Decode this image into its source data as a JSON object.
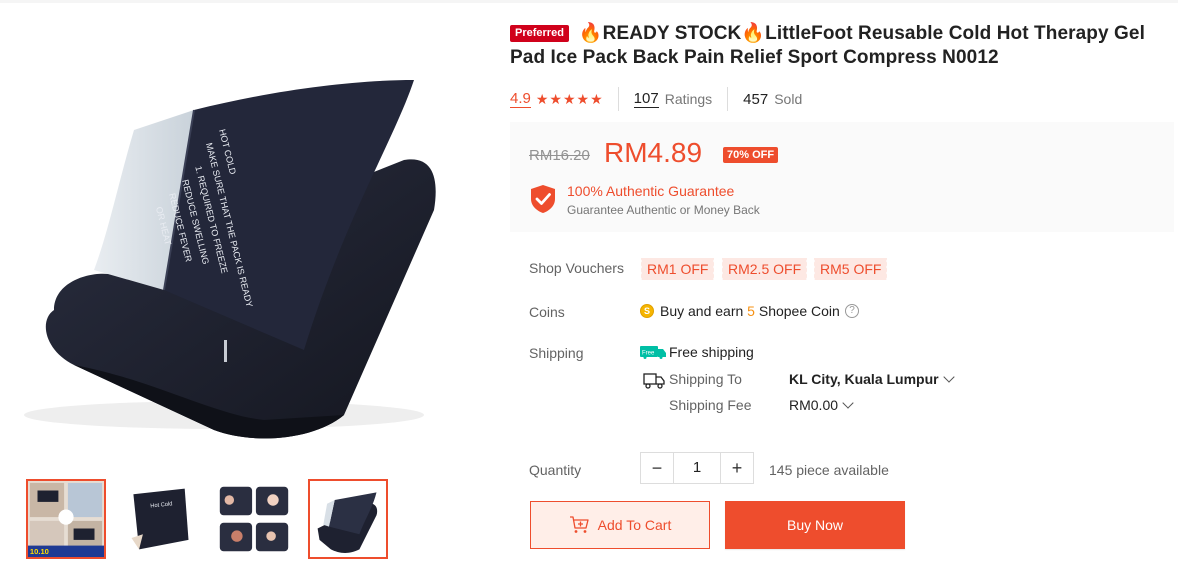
{
  "product": {
    "preferred_badge": "Preferred",
    "title": "🔥READY STOCK🔥LittleFoot Reusable Cold Hot Therapy Gel Pad Ice Pack Back Pain Relief Sport Compress N0012"
  },
  "rating": {
    "value": "4.9",
    "stars": 5,
    "count": "107",
    "count_label": "Ratings",
    "sold": "457",
    "sold_label": "Sold"
  },
  "price": {
    "original": "RM16.20",
    "current": "RM4.89",
    "discount": "70% OFF"
  },
  "guarantee": {
    "title": "100% Authentic Guarantee",
    "subtitle": "Guarantee Authentic or Money Back",
    "icon": "shield-check-icon"
  },
  "vouchers": {
    "label": "Shop Vouchers",
    "items": [
      "RM1 OFF",
      "RM2.5 OFF",
      "RM5 OFF"
    ]
  },
  "coins": {
    "label": "Coins",
    "text_before": "Buy and earn ",
    "amount": "5",
    "text_after": " Shopee Coin",
    "icon": "coin-icon"
  },
  "shipping": {
    "label": "Shipping",
    "free_badge": "Free",
    "free_text": "Free shipping",
    "to_label": "Shipping To",
    "to_value": "KL City, Kuala Lumpur",
    "fee_label": "Shipping Fee",
    "fee_value": "RM0.00"
  },
  "quantity": {
    "label": "Quantity",
    "value": "1",
    "minus": "−",
    "plus": "+",
    "available": "145 piece available"
  },
  "actions": {
    "add_to_cart": "Add To Cart",
    "buy_now": "Buy Now"
  },
  "gallery": {
    "main_text_lines": [
      "HOT  COLD",
      "MAKE SURE THAT THE PACK IS READY",
      "1. REQUIRED TO FREEZE",
      "REDUCE SWELLING",
      "REDUCE FEVER",
      "OR HEAT"
    ],
    "thumb_text": "Hot Cold",
    "thumb_promo": "10.10"
  },
  "colors": {
    "accent": "#ee4d2d",
    "preferred": "#d0011b",
    "pack": "#1e2130"
  }
}
